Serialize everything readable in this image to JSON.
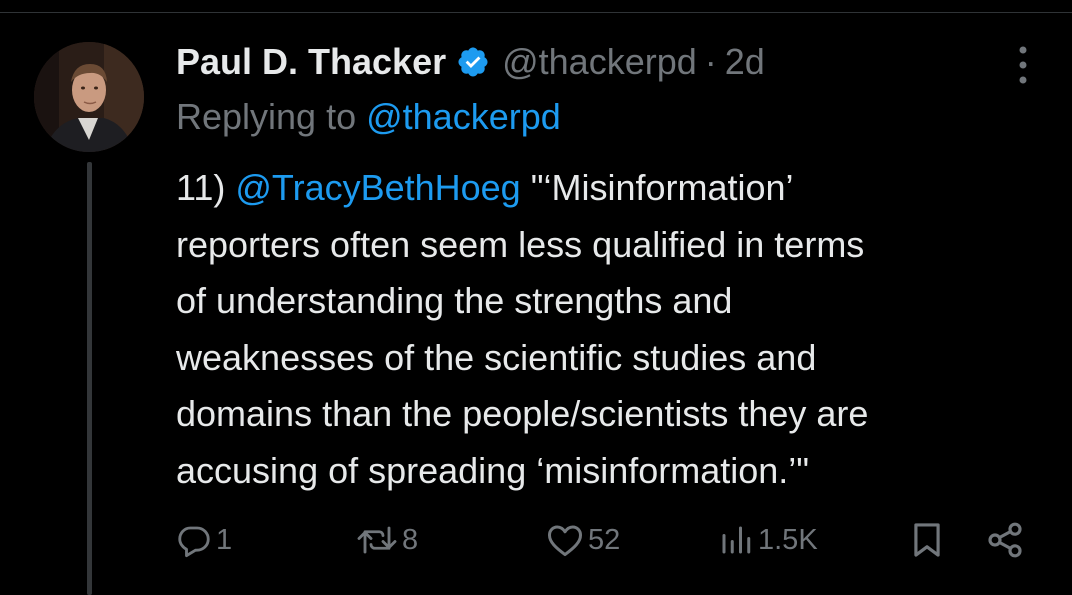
{
  "tweet": {
    "author": {
      "display_name": "Paul D. Thacker",
      "handle": "@thackerpd",
      "verified": true
    },
    "separator": "·",
    "time": "2d",
    "reply_prefix": "Replying to ",
    "reply_to": "@thackerpd",
    "text": {
      "prefix": "11) ",
      "mention": "@TracyBethHoeg",
      "first_line_rest": " \"‘Misinformation’",
      "lines": [
        "reporters often seem less qualified in terms",
        "of understanding the strengths and",
        "weaknesses of the scientific studies and",
        "domains than the people/scientists they are",
        "accusing of spreading ‘misinformation.’\""
      ]
    },
    "actions": {
      "replies": "1",
      "retweets": "8",
      "likes": "52",
      "views": "1.5K"
    }
  },
  "colors": {
    "background": "#000000",
    "text_primary": "#e7e9ea",
    "text_secondary": "#71767b",
    "link": "#1d9bf0",
    "thread_line": "#333639"
  },
  "icons": [
    "verified-badge-icon",
    "more-options-icon",
    "reply-icon",
    "retweet-icon",
    "like-icon",
    "views-icon",
    "bookmark-icon",
    "share-icon"
  ]
}
